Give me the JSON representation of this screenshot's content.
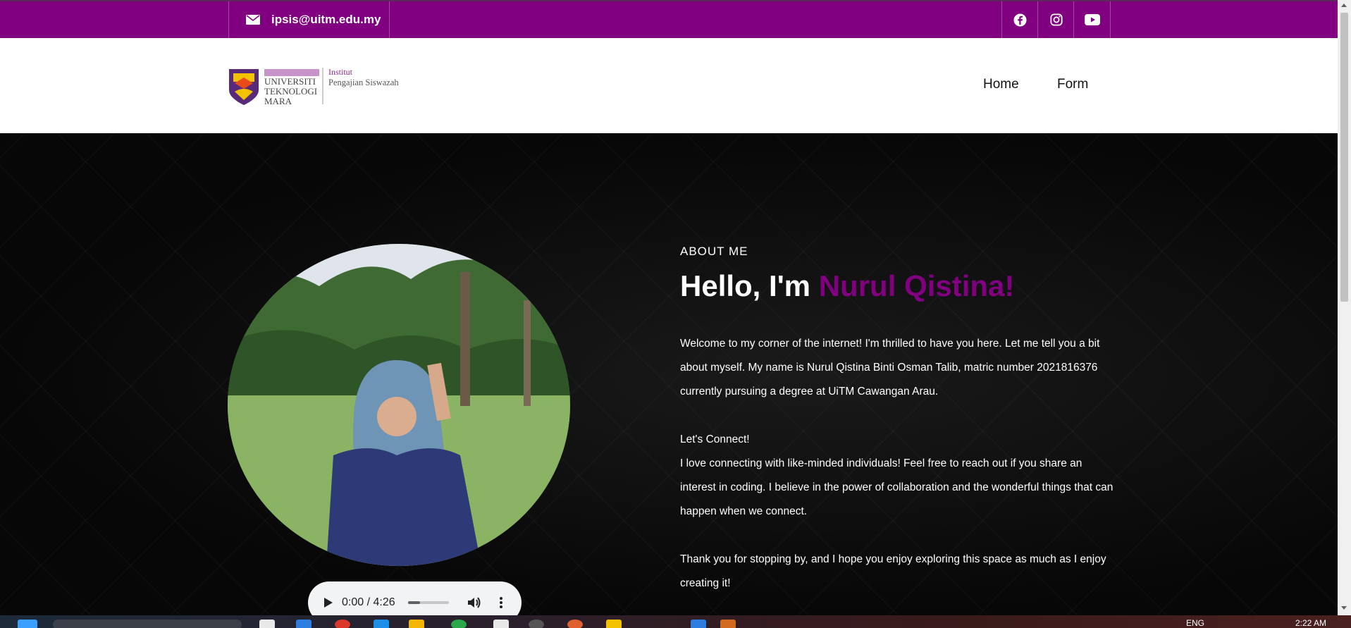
{
  "topbar": {
    "email": "ipsis@uitm.edu.my",
    "social": [
      "facebook-icon",
      "instagram-icon",
      "youtube-icon"
    ]
  },
  "header": {
    "logo": {
      "line1": "UNIVERSITI",
      "line2": "TEKNOLOGI",
      "line3": "MARA",
      "inst1": "Institut",
      "inst2": "Pengajian Siswazah"
    },
    "nav": [
      "Home",
      "Form"
    ]
  },
  "hero": {
    "label": "ABOUT ME",
    "greeting": "Hello, I'm ",
    "name": "Nurul Qistina!",
    "p1": "Welcome to my corner of the internet! I'm thrilled to have you here. Let me tell you a bit about myself. My name is Nurul Qistina Binti Osman Talib, matric number 2021816376 currently pursuing a degree at UiTM Cawangan Arau.",
    "connect_title": "Let's Connect!",
    "p2": "I love connecting with like-minded individuals! Feel free to reach out if you share an interest in coding. I believe in the power of collaboration and the wonderful things that can happen when we connect.",
    "p3": "Thank you for stopping by, and I hope you enjoy exploring this space as much as I enjoy creating it!"
  },
  "audio": {
    "time": "0:00 / 4:26",
    "progress": 0.3
  },
  "taskbar": {
    "lang": "ENG",
    "clock": "2:22 AM"
  },
  "colors": {
    "brand": "#800080",
    "hero_bg": "#000000"
  }
}
